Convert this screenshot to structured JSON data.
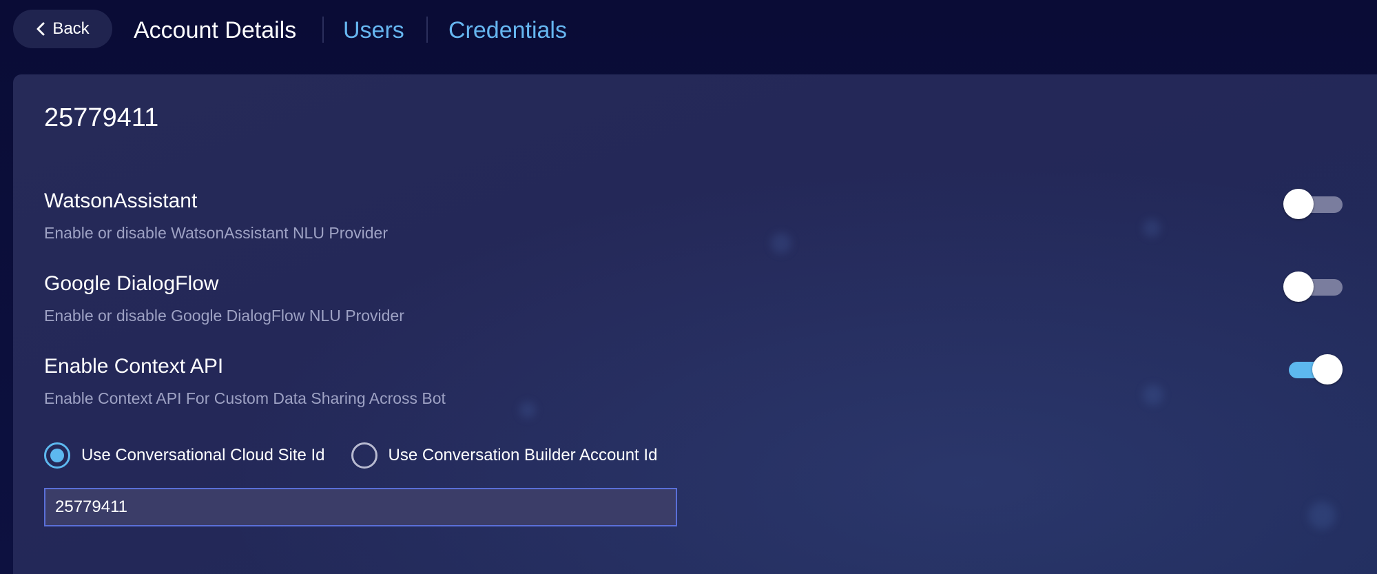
{
  "nav": {
    "back_label": "Back",
    "title": "Account Details",
    "links": [
      "Users",
      "Credentials"
    ]
  },
  "account": {
    "id": "25779411"
  },
  "settings": [
    {
      "title": "WatsonAssistant",
      "description": "Enable or disable WatsonAssistant NLU Provider",
      "enabled": false
    },
    {
      "title": "Google DialogFlow",
      "description": "Enable or disable Google DialogFlow NLU Provider",
      "enabled": false
    },
    {
      "title": "Enable Context API",
      "description": "Enable Context API For Custom Data Sharing Across Bot",
      "enabled": true
    }
  ],
  "id_source": {
    "options": [
      "Use Conversational Cloud Site Id",
      "Use Conversation Builder Account Id"
    ],
    "selected": "Use Conversational Cloud Site Id",
    "value": "25779411"
  },
  "colors": {
    "accent": "#5db8ef",
    "link": "#66b6f0",
    "background": "#0b0e3a",
    "card": "#242858"
  },
  "icons": {
    "back": "chevron-left-icon"
  }
}
